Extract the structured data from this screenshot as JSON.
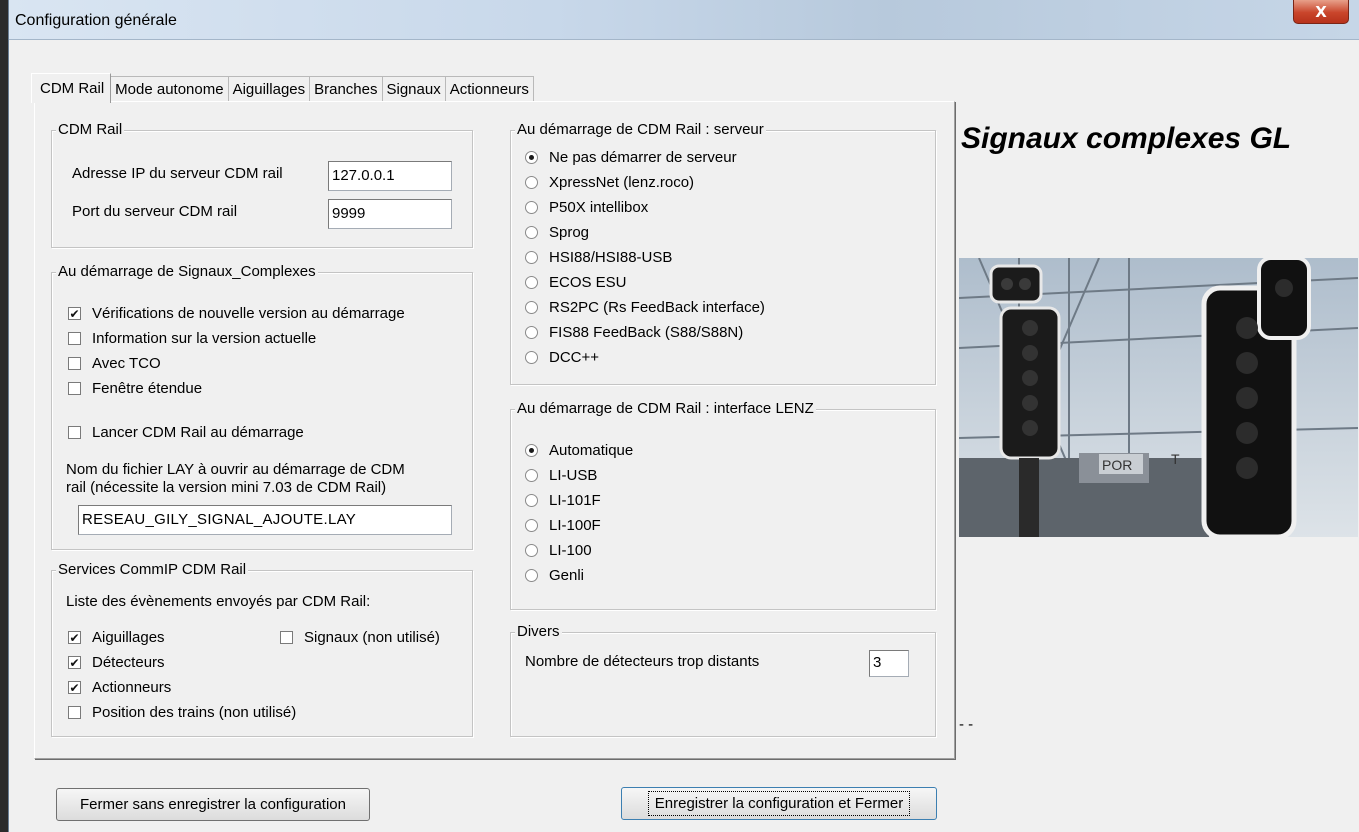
{
  "window": {
    "title": "Configuration générale",
    "close_glyph": "X"
  },
  "tabs": [
    "CDM Rail",
    "Mode autonome",
    "Aiguillages",
    "Branches",
    "Signaux",
    "Actionneurs"
  ],
  "cdm": {
    "legend": "CDM Rail",
    "ip_label": "Adresse IP du serveur CDM rail",
    "ip_value": "127.0.0.1",
    "port_label": "Port du serveur CDM rail",
    "port_value": "9999"
  },
  "startup": {
    "legend": "Au démarrage de Signaux_Complexes",
    "options": [
      {
        "label": "Vérifications de nouvelle version au démarrage",
        "checked": true
      },
      {
        "label": "Information sur la version actuelle",
        "checked": false
      },
      {
        "label": "Avec TCO",
        "checked": false
      },
      {
        "label": "Fenêtre étendue",
        "checked": false
      }
    ],
    "launch_label": "Lancer CDM Rail au démarrage",
    "launch_checked": false,
    "lay_text_1": "Nom du fichier LAY à ouvrir au démarrage de CDM",
    "lay_text_2": "rail (nécessite la version mini 7.03 de CDM Rail)",
    "lay_value": "RESEAU_GILY_SIGNAL_AJOUTE.LAY"
  },
  "services": {
    "legend": "Services CommIP CDM Rail",
    "intro": "Liste des évènements envoyés par CDM Rail:",
    "signaux": {
      "label": "Signaux (non utilisé)",
      "checked": false
    },
    "items": [
      {
        "label": "Aiguillages",
        "checked": true
      },
      {
        "label": "Détecteurs",
        "checked": true
      },
      {
        "label": "Actionneurs",
        "checked": true
      },
      {
        "label": "Position des trains (non utilisé)",
        "checked": false
      }
    ]
  },
  "server": {
    "legend": "Au démarrage de CDM Rail : serveur",
    "selected": 0,
    "options": [
      "Ne pas démarrer de serveur",
      "XpressNet (lenz.roco)",
      "P50X intellibox",
      "Sprog",
      "HSI88/HSI88-USB",
      "ECOS ESU",
      "RS2PC (Rs FeedBack interface)",
      "FIS88 FeedBack (S88/S88N)",
      "DCC++"
    ]
  },
  "lenz": {
    "legend": "Au démarrage de CDM Rail : interface LENZ",
    "selected": 0,
    "options": [
      "Automatique",
      "LI-USB",
      "LI-101F",
      "LI-100F",
      "LI-100",
      "Genli"
    ]
  },
  "divers": {
    "legend": "Divers",
    "label": "Nombre de détecteurs trop distants",
    "value": "3"
  },
  "side": {
    "heading": "Signaux complexes GL",
    "dash": "-   -",
    "photo_text_1": "POR",
    "photo_text_2": "T"
  },
  "buttons": {
    "cancel": "Fermer sans enregistrer la configuration",
    "save": "Enregistrer la configuration et Fermer"
  }
}
